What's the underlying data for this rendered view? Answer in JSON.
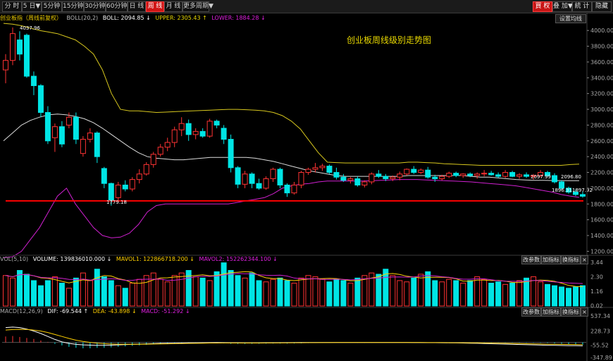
{
  "toolbar": {
    "tabs": [
      {
        "label": "分 时",
        "active": false
      },
      {
        "label": "5 日▼",
        "active": false
      },
      {
        "label": "5分钟",
        "active": false
      },
      {
        "label": "15分钟",
        "active": false
      },
      {
        "label": "30分钟",
        "active": false
      },
      {
        "label": "60分钟",
        "active": false
      },
      {
        "label": "日 线",
        "active": false
      },
      {
        "label": "周 线",
        "active": true
      },
      {
        "label": "月 线",
        "active": false
      },
      {
        "label": "更多周期▼",
        "active": false
      }
    ],
    "right_buttons": {
      "buy": "買 权",
      "add": "叠 加▼",
      "stats": "統 计",
      "hide": "隐藏"
    }
  },
  "main_legend": {
    "name": "创业板指（周线前复权）",
    "boll": "BOLL(20,2)",
    "mid": "BOLL: 2094.85 ↓",
    "upper": "UPPER: 2305.43 ↑",
    "lower": "LOWER: 1884.28 ↓",
    "settings": "设置均线"
  },
  "annotation": "创业板周线级别走势图",
  "price_labels": {
    "high": "4037.96",
    "low": "1779.18",
    "last": "1897.92",
    "ref1": "2097.99",
    "ref2": "2096.80",
    "ref3": "1896.31"
  },
  "colors": {
    "up": "#ff3333",
    "down": "#00e5e5",
    "upper": "#d8c81e",
    "mid": "#dcdcdc",
    "lower": "#d020d0",
    "support": "#ff0000",
    "mavol1": "#ffd000",
    "mavol2": "#d020d0",
    "dif": "#ffffff",
    "dea": "#ffd000"
  },
  "volume": {
    "label": "VOL(5,10)",
    "volume": "VOLUME: 139836010.000 ↓",
    "mavol1": "MAVOL1: 122866718.200 ↓",
    "mavol2": "MAVOL2: 152262344.100 ↓",
    "buttons": [
      "改参数",
      "加指标",
      "换指标",
      "×"
    ],
    "axis": [
      "3.44",
      "2.30",
      "1.16",
      "0.02"
    ]
  },
  "macd": {
    "label": "MACD(12,26,9)",
    "dif": "DIF: -69.544 ↑",
    "dea": "DEA: -43.898 ↓",
    "macd": "MACD: -51.292 ↓",
    "buttons": [
      "改参数",
      "加指标",
      "换指标",
      "×"
    ],
    "axis": [
      "537.34",
      "228.73",
      "-55.52",
      "-347.89"
    ]
  },
  "chart_data": {
    "type": "candlestick",
    "y_ticks": [
      4000,
      3800,
      3600,
      3400,
      3200,
      3000,
      2800,
      2600,
      2400,
      2200,
      2000,
      1800,
      1600,
      1400,
      1200
    ],
    "ylim": [
      1150,
      4100
    ],
    "candles": [
      [
        3500,
        3700,
        3330,
        3620
      ],
      [
        3620,
        4037.96,
        3560,
        3960
      ],
      [
        3880,
        3990,
        3620,
        3700
      ],
      [
        3940,
        3960,
        3400,
        3420
      ],
      [
        3420,
        3480,
        3180,
        3300
      ],
      [
        3300,
        3320,
        2900,
        2960
      ],
      [
        2960,
        3040,
        2560,
        2600
      ],
      [
        2640,
        2820,
        2460,
        2780
      ],
      [
        2780,
        2850,
        2520,
        2560
      ],
      [
        2800,
        2960,
        2760,
        2900
      ],
      [
        2900,
        2960,
        2560,
        2620
      ],
      [
        2440,
        2660,
        2400,
        2620
      ],
      [
        2620,
        2760,
        2580,
        2700
      ],
      [
        2700,
        2720,
        2320,
        2400
      ],
      [
        2250,
        2270,
        2000,
        2060
      ],
      [
        2060,
        2070,
        1779.18,
        1850
      ],
      [
        1880,
        2080,
        1840,
        2040
      ],
      [
        2040,
        2100,
        1960,
        1990
      ],
      [
        1990,
        2140,
        1960,
        2110
      ],
      [
        2110,
        2240,
        2060,
        2180
      ],
      [
        2180,
        2330,
        2160,
        2300
      ],
      [
        2300,
        2460,
        2260,
        2430
      ],
      [
        2430,
        2560,
        2400,
        2520
      ],
      [
        2520,
        2640,
        2470,
        2580
      ],
      [
        2580,
        2780,
        2520,
        2740
      ],
      [
        2740,
        2900,
        2660,
        2820
      ],
      [
        2820,
        2870,
        2600,
        2680
      ],
      [
        2680,
        2760,
        2620,
        2720
      ],
      [
        2720,
        2760,
        2640,
        2660
      ],
      [
        2660,
        2880,
        2640,
        2850
      ],
      [
        2850,
        2870,
        2760,
        2800
      ],
      [
        2760,
        2800,
        2560,
        2620
      ],
      [
        2620,
        2680,
        2200,
        2260
      ],
      [
        2260,
        2280,
        2000,
        2050
      ],
      [
        2050,
        2220,
        2000,
        2180
      ],
      [
        2180,
        2200,
        2000,
        2060
      ],
      [
        2060,
        2120,
        1980,
        2000
      ],
      [
        2000,
        2150,
        1980,
        2120
      ],
      [
        2120,
        2260,
        2080,
        2240
      ],
      [
        2240,
        2260,
        2000,
        2040
      ],
      [
        2040,
        2060,
        1890,
        1940
      ],
      [
        1940,
        2080,
        1920,
        2040
      ],
      [
        2040,
        2220,
        2000,
        2200
      ],
      [
        2200,
        2260,
        2170,
        2240
      ],
      [
        2240,
        2320,
        2200,
        2260
      ],
      [
        2260,
        2310,
        2220,
        2280
      ],
      [
        2280,
        2300,
        2180,
        2200
      ],
      [
        2200,
        2260,
        2110,
        2140
      ],
      [
        2140,
        2180,
        2080,
        2100
      ],
      [
        2100,
        2140,
        2060,
        2120
      ],
      [
        2120,
        2150,
        2020,
        2040
      ],
      [
        2040,
        2100,
        2010,
        2080
      ],
      [
        2080,
        2200,
        2050,
        2180
      ],
      [
        2180,
        2230,
        2130,
        2150
      ],
      [
        2150,
        2180,
        2090,
        2120
      ],
      [
        2120,
        2160,
        2090,
        2140
      ],
      [
        2140,
        2210,
        2100,
        2180
      ],
      [
        2180,
        2250,
        2160,
        2240
      ],
      [
        2240,
        2280,
        2180,
        2200
      ],
      [
        2200,
        2250,
        2180,
        2230
      ],
      [
        2230,
        2270,
        2120,
        2140
      ],
      [
        2140,
        2170,
        2080,
        2120
      ],
      [
        2120,
        2170,
        2100,
        2150
      ],
      [
        2150,
        2210,
        2130,
        2190
      ],
      [
        2190,
        2210,
        2140,
        2160
      ],
      [
        2160,
        2190,
        2130,
        2180
      ],
      [
        2180,
        2200,
        2140,
        2160
      ],
      [
        2160,
        2200,
        2120,
        2180
      ],
      [
        2180,
        2230,
        2150,
        2190
      ],
      [
        2190,
        2220,
        2160,
        2170
      ],
      [
        2170,
        2200,
        2130,
        2150
      ],
      [
        2150,
        2230,
        2130,
        2200
      ],
      [
        2200,
        2220,
        2140,
        2150
      ],
      [
        2150,
        2190,
        2120,
        2170
      ],
      [
        2170,
        2200,
        2130,
        2150
      ],
      [
        2150,
        2180,
        2110,
        2160
      ],
      [
        2160,
        2230,
        2140,
        2200
      ],
      [
        2200,
        2220,
        2150,
        2160
      ],
      [
        2160,
        2190,
        2060,
        2080
      ],
      [
        2080,
        2100,
        1980,
        2000
      ],
      [
        2000,
        2020,
        1930,
        1950
      ],
      [
        1950,
        1980,
        1900,
        1920
      ],
      [
        1920,
        1960,
        1880,
        1897.92
      ]
    ],
    "upper": [
      4090,
      4080,
      4060,
      4030,
      4000,
      3980,
      3960,
      3920,
      3880,
      3800,
      3700,
      3500,
      3200,
      3000,
      2980,
      2980,
      2970,
      2960,
      2965,
      2970,
      2975,
      2980,
      2985,
      2990,
      2995,
      3000,
      3000,
      2995,
      2990,
      2980,
      2960,
      2920,
      2850,
      2750,
      2600,
      2450,
      2330,
      2325,
      2320,
      2320,
      2320,
      2320,
      2320,
      2320,
      2320,
      2330,
      2330,
      2325,
      2320,
      2310,
      2305,
      2300,
      2295,
      2290,
      2290,
      2290,
      2290,
      2290,
      2290,
      2290,
      2290,
      2290,
      2290,
      2300,
      2305.43
    ],
    "mid": [
      2600,
      2700,
      2800,
      2860,
      2900,
      2930,
      2940,
      2930,
      2910,
      2880,
      2830,
      2760,
      2680,
      2600,
      2520,
      2450,
      2400,
      2380,
      2370,
      2360,
      2360,
      2370,
      2380,
      2390,
      2390,
      2390,
      2390,
      2390,
      2380,
      2360,
      2340,
      2310,
      2280,
      2250,
      2220,
      2200,
      2180,
      2160,
      2150,
      2150,
      2150,
      2150,
      2150,
      2150,
      2150,
      2160,
      2160,
      2160,
      2160,
      2160,
      2160,
      2160,
      2150,
      2140,
      2140,
      2130,
      2120,
      2110,
      2105,
      2100,
      2100,
      2098,
      2097,
      2096,
      2094.85
    ],
    "lower": [
      1120,
      1130,
      1200,
      1350,
      1500,
      1700,
      1900,
      2000,
      1800,
      1650,
      1500,
      1400,
      1370,
      1380,
      1430,
      1540,
      1700,
      1780,
      1800,
      1800,
      1800,
      1800,
      1800,
      1800,
      1800,
      1800,
      1820,
      1840,
      1860,
      1880,
      1930,
      2000,
      2030,
      2050,
      2060,
      2080,
      2090,
      2090,
      2090,
      2090,
      2090,
      2095,
      2100,
      2105,
      2110,
      2110,
      2110,
      2105,
      2100,
      2095,
      2090,
      2085,
      2080,
      2070,
      2060,
      2050,
      2040,
      2030,
      2010,
      1990,
      1970,
      1950,
      1920,
      1900,
      1884.28
    ],
    "support": 1840,
    "vol": [
      2.4,
      2.2,
      2.8,
      2.5,
      2.0,
      1.6,
      2.0,
      2.3,
      1.8,
      1.4,
      2.2,
      2.6,
      2.0,
      2.9,
      2.3,
      2.0,
      1.6,
      1.4,
      1.8,
      2.1,
      2.4,
      2.6,
      2.1,
      1.9,
      2.4,
      2.6,
      2.8,
      2.3,
      2.2,
      2.0,
      2.7,
      3.4,
      2.8,
      2.4,
      2.2,
      2.6,
      2.0,
      1.9,
      2.1,
      2.2,
      2.0,
      1.8,
      2.2,
      2.4,
      2.3,
      2.1,
      1.9,
      2.1,
      2.0,
      1.8,
      2.2,
      2.4,
      2.6,
      2.5,
      2.9,
      2.4,
      2.0,
      1.9,
      2.2,
      2.5,
      2.7,
      2.0,
      1.9,
      2.1,
      2.0,
      1.8,
      2.0,
      2.3,
      2.1,
      1.8,
      1.9,
      1.7,
      1.8,
      2.0,
      2.2,
      2.3,
      1.9,
      1.7,
      1.6,
      1.5,
      1.4,
      1.5,
      1.6
    ],
    "macd_hist": [
      120,
      130,
      110,
      90,
      70,
      40,
      10,
      -30,
      -60,
      -90,
      -110,
      -120,
      -120,
      -110,
      -110,
      -100,
      -90,
      -80,
      -70,
      -60,
      -50,
      -40,
      -35,
      -30,
      -25,
      -20,
      -15,
      -10,
      -8,
      -10,
      -14,
      -20,
      -28,
      -30,
      -30,
      -28,
      -26,
      -24,
      -22,
      -22,
      -24,
      -22,
      -18,
      -14,
      -10,
      -8,
      -6,
      -5,
      -5,
      -6,
      -8,
      -8,
      -6,
      -5,
      -4,
      -4,
      -3,
      -3,
      -3,
      -4,
      -4,
      -3,
      -3,
      -3,
      -4,
      -4,
      -4,
      -5,
      -6,
      -6,
      -5,
      -5,
      -6,
      -7,
      -8,
      -8,
      -10,
      -14,
      -20,
      -28,
      -36,
      -44,
      -51.292
    ],
    "dif": [
      300,
      310,
      300,
      270,
      230,
      180,
      120,
      60,
      10,
      -20,
      -40,
      -50,
      -55,
      -60,
      -60,
      -55,
      -50,
      -45,
      -40,
      -35,
      -30,
      -25,
      -20,
      -18,
      -15,
      -12,
      -10,
      -8,
      -6,
      -5,
      -4,
      -5,
      -8,
      -10,
      -12,
      -12,
      -12,
      -10,
      -8,
      -6,
      -5,
      -4,
      -3,
      -3,
      -3,
      -2,
      -2,
      -2,
      -2,
      -2,
      -2,
      -2,
      -2,
      -2,
      -3,
      -3,
      -3,
      -3,
      -4,
      -4,
      -5,
      -5,
      -6,
      -8,
      -10,
      -12,
      -15,
      -18,
      -22,
      -26,
      -30,
      -34,
      -38,
      -42,
      -46,
      -50,
      -54,
      -58,
      -60,
      -63,
      -65,
      -67,
      -69.544
    ],
    "dea": [
      250,
      260,
      265,
      262,
      250,
      230,
      200,
      160,
      120,
      80,
      45,
      20,
      0,
      -15,
      -25,
      -32,
      -36,
      -38,
      -38,
      -37,
      -35,
      -33,
      -30,
      -28,
      -25,
      -22,
      -20,
      -18,
      -15,
      -13,
      -12,
      -11,
      -11,
      -11,
      -11,
      -11,
      -11,
      -10,
      -10,
      -9,
      -8,
      -7,
      -6,
      -5,
      -5,
      -4,
      -4,
      -3,
      -3,
      -3,
      -3,
      -3,
      -3,
      -3,
      -3,
      -3,
      -3,
      -3,
      -3,
      -3,
      -4,
      -4,
      -4,
      -5,
      -6,
      -7,
      -8,
      -10,
      -12,
      -14,
      -16,
      -18,
      -21,
      -24,
      -27,
      -30,
      -33,
      -36,
      -38,
      -40,
      -41,
      -43,
      -43.898
    ]
  }
}
